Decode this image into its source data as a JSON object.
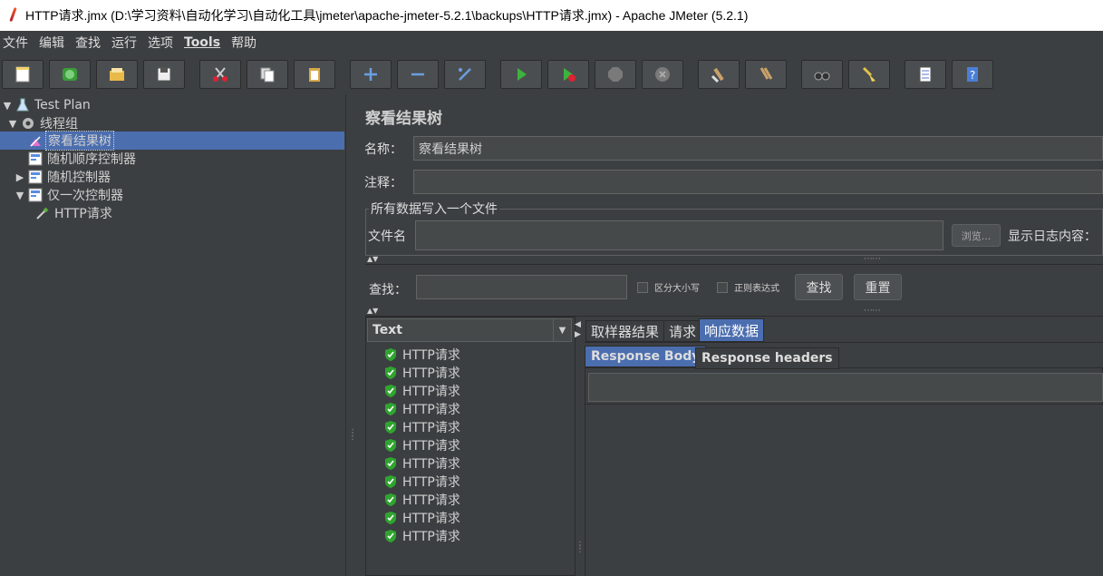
{
  "window": {
    "title": "HTTP请求.jmx (D:\\学习资料\\自动化学习\\自动化工具\\jmeter\\apache-jmeter-5.2.1\\backups\\HTTP请求.jmx) - Apache JMeter (5.2.1)"
  },
  "menu": [
    "文件",
    "编辑",
    "查找",
    "运行",
    "选项",
    "Tools",
    "帮助"
  ],
  "toolbar": [
    {
      "name": "new-icon"
    },
    {
      "name": "templates-icon"
    },
    {
      "name": "open-icon"
    },
    {
      "name": "save-icon"
    },
    {
      "name": "cut-icon"
    },
    {
      "name": "copy-icon"
    },
    {
      "name": "paste-icon"
    },
    {
      "name": "expand-icon"
    },
    {
      "name": "collapse-icon"
    },
    {
      "name": "toggle-icon"
    },
    {
      "name": "start-icon"
    },
    {
      "name": "start-no-pause-icon"
    },
    {
      "name": "stop-icon"
    },
    {
      "name": "shutdown-icon"
    },
    {
      "name": "clear-icon"
    },
    {
      "name": "clear-all-icon"
    },
    {
      "name": "search-icon"
    },
    {
      "name": "reset-search-icon"
    },
    {
      "name": "function-helper-icon"
    },
    {
      "name": "help-icon"
    }
  ],
  "tree": [
    {
      "label": "Test Plan",
      "icon": "flask-icon",
      "arrow": "▼"
    },
    {
      "label": "线程组",
      "icon": "gear-icon",
      "arrow": "▼"
    },
    {
      "label": "察看结果树",
      "icon": "listener-icon",
      "arrow": ""
    },
    {
      "label": "随机顺序控制器",
      "icon": "controller-icon",
      "arrow": ""
    },
    {
      "label": "随机控制器",
      "icon": "controller-icon",
      "arrow": "▶"
    },
    {
      "label": "仅一次控制器",
      "icon": "controller-icon",
      "arrow": "▼"
    },
    {
      "label": "HTTP请求",
      "icon": "pipette-icon",
      "arrow": ""
    }
  ],
  "panel": {
    "title": "察看结果树",
    "name_label": "名称：",
    "name_value": "察看结果树",
    "comment_label": "注释：",
    "comment_value": "",
    "file_group": "所有数据写入一个文件",
    "file_label": "文件名",
    "browse_label": "浏览...",
    "log_label": "显示日志内容：",
    "search_label": "查找：",
    "case_label": "区分大小写",
    "regex_label": "正则表达式",
    "find_button": "查找",
    "reset_button": "重置"
  },
  "results": {
    "renderer": "Text",
    "items": [
      "HTTP请求",
      "HTTP请求",
      "HTTP请求",
      "HTTP请求",
      "HTTP请求",
      "HTTP请求",
      "HTTP请求",
      "HTTP请求",
      "HTTP请求",
      "HTTP请求",
      "HTTP请求"
    ]
  },
  "tabs": [
    "取样器结果",
    "请求",
    "响应数据"
  ],
  "subtabs": [
    "Response Body",
    "Response headers"
  ]
}
